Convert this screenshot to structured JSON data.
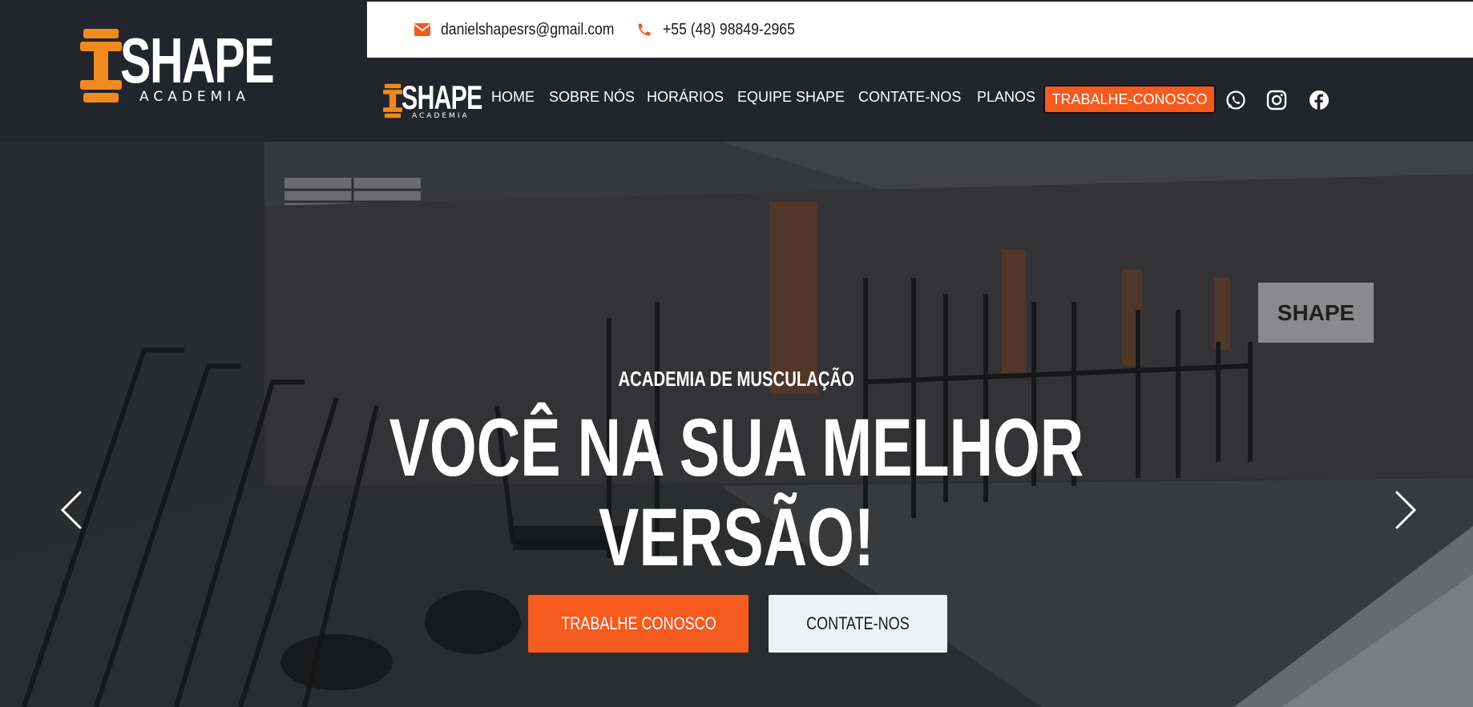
{
  "brand": {
    "logo_word": "SHAPE",
    "logo_sub": "ACADEMIA",
    "accent": "#f55a1e",
    "header_bg": "#23252c"
  },
  "topbar": {
    "email": "danielshapesrs@gmail.com",
    "phone": "+55 (48) 98849-2965",
    "email_icon": "envelope-icon",
    "phone_icon": "phone-icon"
  },
  "nav": {
    "items": [
      "HOME",
      "SOBRE NÓS",
      "HORÁRIOS",
      "EQUIPE SHAPE",
      "CONTATE-NOS",
      "PLANOS"
    ],
    "cta": "TRABALHE-CONOSCO",
    "social_icons": [
      "whatsapp-icon",
      "instagram-icon",
      "facebook-icon"
    ]
  },
  "hero": {
    "kicker": "ACADEMIA DE MUSCULAÇÃO",
    "title_line1": "VOCÊ NA SUA MELHOR",
    "title_line2": "VERSÃO!",
    "primary_button": "TRABALHE CONOSCO",
    "secondary_button": "CONTATE-NOS",
    "wall_sign": "SHAPE"
  }
}
